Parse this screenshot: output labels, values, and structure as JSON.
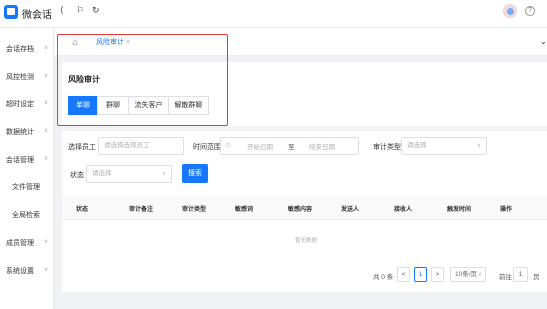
{
  "header": {
    "app_title": "微会话",
    "icons": [
      "back-icon",
      "flag-icon",
      "refresh-icon"
    ],
    "help_glyph": "?"
  },
  "sidebar": {
    "items": [
      {
        "label": "会话存档",
        "chev": "∨"
      },
      {
        "label": "风控检测",
        "chev": "∨"
      },
      {
        "label": "超时设定",
        "chev": "∨"
      },
      {
        "label": "数据统计",
        "chev": "∨"
      },
      {
        "label": "会话管理",
        "chev": "∧"
      },
      {
        "label": "文件管理",
        "chev": ""
      },
      {
        "label": "全局检索",
        "chev": ""
      },
      {
        "label": "成员管理",
        "chev": "∨"
      },
      {
        "label": "系统设置",
        "chev": "∨"
      }
    ]
  },
  "tabs": {
    "active": "风险审计",
    "close": "×"
  },
  "audit": {
    "title": "风险审计",
    "segments": [
      "单聊",
      "群聊",
      "流失客户",
      "解散群聊"
    ],
    "active_segment": 0
  },
  "filters": {
    "employee_label": "选择员工",
    "employee_placeholder": "请选择选择员工",
    "time_label": "时间范围",
    "start_placeholder": "开始日期",
    "range_sep": "至",
    "end_placeholder": "结束日期",
    "audit_type_label": "审计类型",
    "audit_type_placeholder": "请选择",
    "status_label": "状态",
    "status_placeholder": "请选择",
    "search_button": "搜索"
  },
  "table": {
    "columns": [
      "状态",
      "审计备注",
      "审计类型",
      "敏感词",
      "敏感内容",
      "发送人",
      "接收人",
      "触发时间",
      "操作"
    ],
    "empty_text": "暂无数据"
  },
  "pagination": {
    "total": "共 0 条",
    "current_page": "1",
    "page_size": "10条/页",
    "goto_label": "前往",
    "goto_value": "1",
    "page_suffix": "页"
  },
  "colors": {
    "accent": "#1677ff",
    "highlight": "#e53935",
    "background": "#f0f2f5"
  }
}
